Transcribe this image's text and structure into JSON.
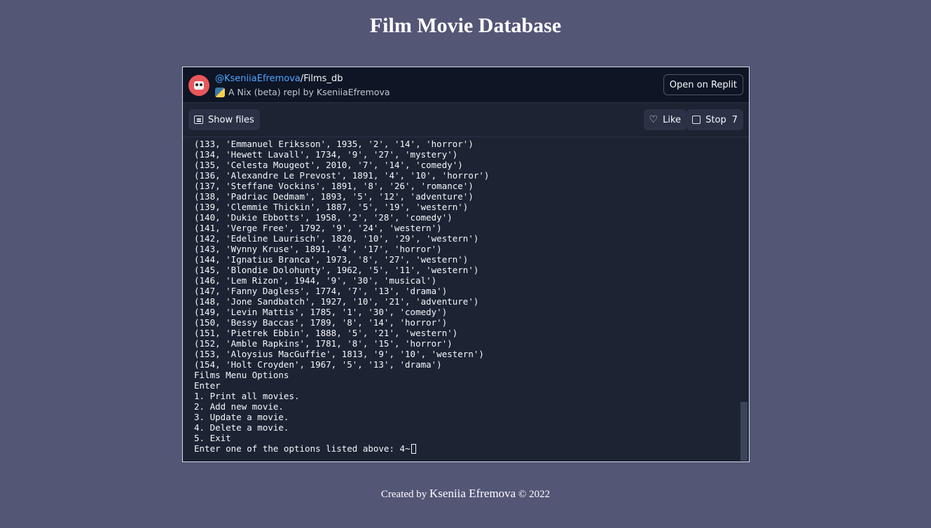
{
  "page": {
    "title": "Film Movie Database"
  },
  "embed": {
    "owner": "@KseniiaEfremova",
    "separator": "/",
    "repl_name": "Films_db",
    "subtitle": "A Nix (beta) repl by KseniiaEfremova",
    "open_button": "Open on Replit",
    "show_files": "Show files",
    "like": "Like",
    "stop": "Stop",
    "stop_count": "7",
    "icons": [
      "avatar-icon",
      "python-icon",
      "files-icon",
      "heart-icon",
      "square-icon"
    ]
  },
  "console": {
    "lines": [
      "(133, 'Emmanuel Eriksson', 1935, '2', '14', 'horror')",
      "(134, 'Hewett Lavall', 1734, '9', '27', 'mystery')",
      "(135, 'Celesta Mougeot', 2010, '7', '14', 'comedy')",
      "(136, 'Alexandre Le Prevost', 1891, '4', '10', 'horror')",
      "(137, 'Steffane Vockins', 1891, '8', '26', 'romance')",
      "(138, 'Padriac Dedmam', 1893, '5', '12', 'adventure')",
      "(139, 'Clemmie Thickin', 1887, '5', '19', 'western')",
      "(140, 'Dukie Ebbotts', 1958, '2', '28', 'comedy')",
      "(141, 'Verge Free', 1792, '9', '24', 'western')",
      "(142, 'Edeline Laurisch', 1820, '10', '29', 'western')",
      "(143, 'Wynny Kruse', 1891, '4', '17', 'horror')",
      "(144, 'Ignatius Branca', 1973, '8', '27', 'western')",
      "(145, 'Blondie Dolohunty', 1962, '5', '11', 'western')",
      "(146, 'Lem Rizon', 1944, '9', '30', 'musical')",
      "(147, 'Fanny Dagless', 1774, '7', '13', 'drama')",
      "(148, 'Jone Sandbatch', 1927, '10', '21', 'adventure')",
      "(149, 'Levin Mattis', 1785, '1', '30', 'comedy')",
      "(150, 'Bessy Baccas', 1789, '8', '14', 'horror')",
      "(151, 'Pietrek Ebbin', 1888, '5', '21', 'western')",
      "(152, 'Amble Rapkins', 1781, '8', '15', 'horror')",
      "(153, 'Aloysius MacGuffie', 1813, '9', '10', 'western')",
      "(154, 'Holt Croyden', 1967, '5', '13', 'drama')",
      "Films Menu Options",
      "Enter",
      "1. Print all movies.",
      "2. Add new movie.",
      "3. Update a movie.",
      "4. Delete a movie.",
      "5. Exit"
    ],
    "prompt": "Enter one of the options listed above: 4~"
  },
  "footer": {
    "prefix": "Created by ",
    "author": "Kseniia Efremova",
    "suffix": " © 2022"
  },
  "colors": {
    "background": "#545676",
    "embed_bg": "#1c2333",
    "header_bg": "#0e1525",
    "owner_link": "#4da6ff",
    "avatar": "#e8575a"
  }
}
